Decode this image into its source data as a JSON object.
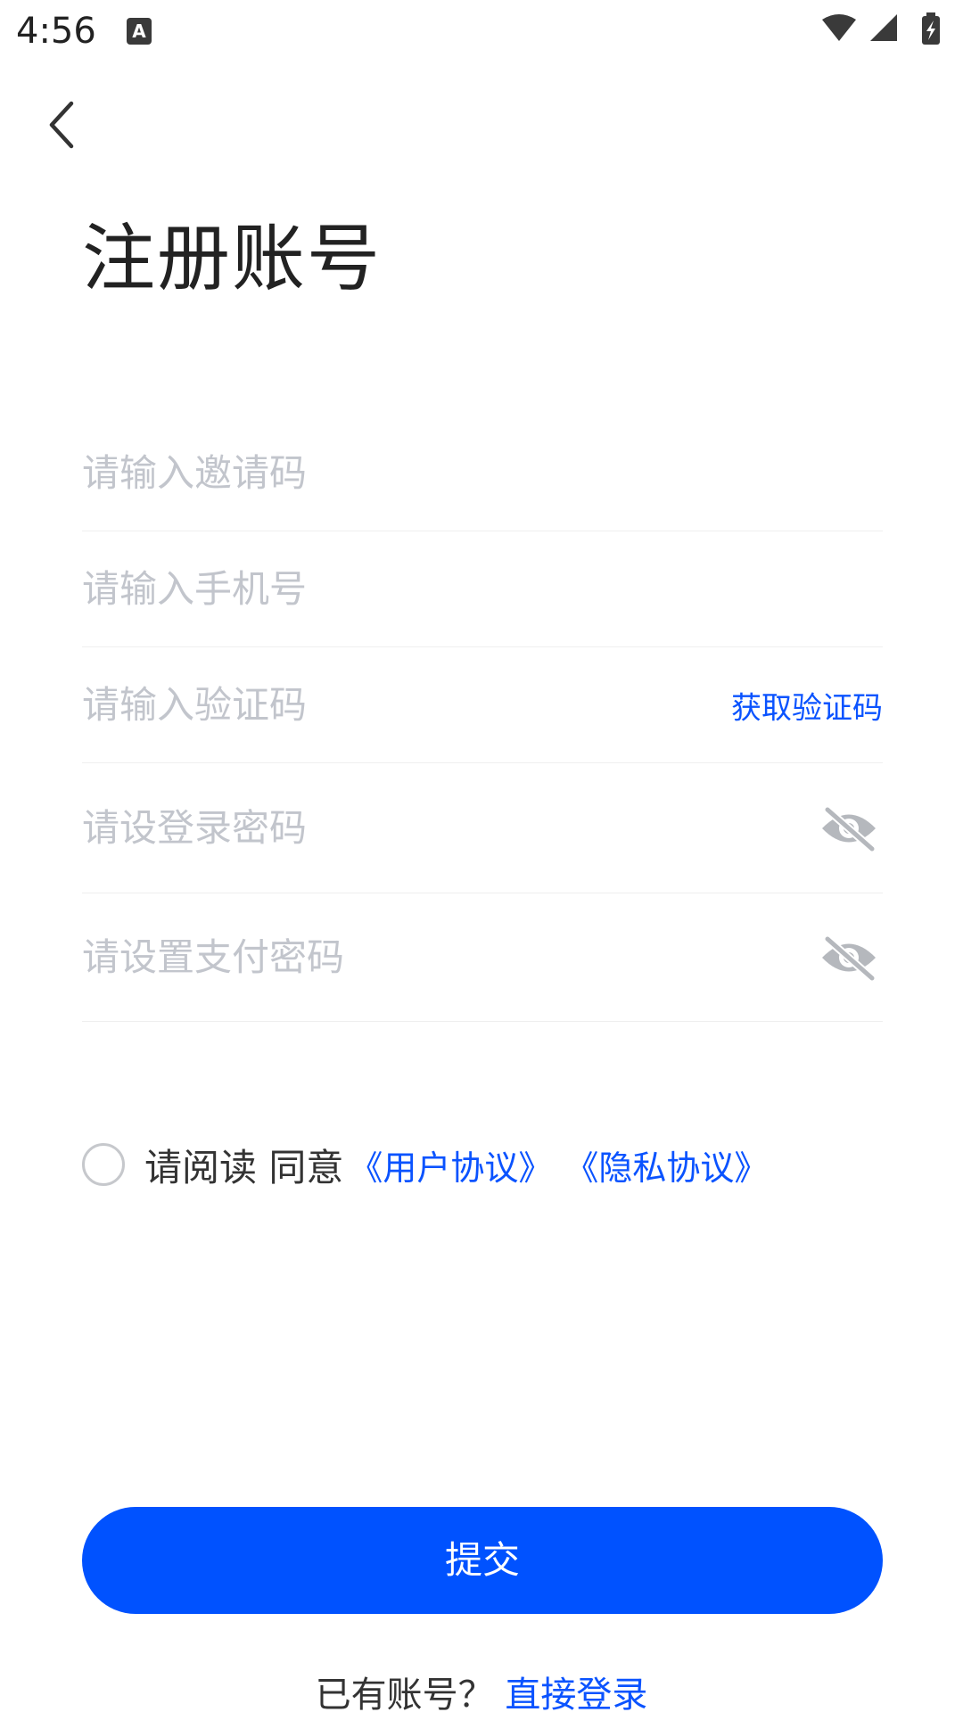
{
  "status_bar": {
    "time": "4:56",
    "notification_icon_letter": "A",
    "icons": [
      "wifi-icon",
      "cellular-signal-icon",
      "battery-charging-icon"
    ]
  },
  "header": {
    "back_icon": "chevron-left-icon",
    "title": "注册账号"
  },
  "form": {
    "invite_code_placeholder": "请输入邀请码",
    "phone_placeholder": "请输入手机号",
    "sms_code_placeholder": "请输入验证码",
    "get_sms_code_label": "获取验证码",
    "login_password_placeholder": "请设登录密码",
    "pay_password_placeholder": "请设置支付密码",
    "password_toggle_icon": "eye-hidden-icon"
  },
  "agreement": {
    "prefix": "请阅读 同意",
    "user_agreement": "《用户协议》",
    "privacy_policy": "《隐私协议》",
    "checked": false
  },
  "submit_label": "提交",
  "footer": {
    "prompt": "已有账号？",
    "login_link": "直接登录"
  },
  "colors": {
    "primary": "#0052ff",
    "link": "#0a53ff",
    "placeholder": "#c2c5cc",
    "divider": "#efefef",
    "text": "#222222"
  }
}
